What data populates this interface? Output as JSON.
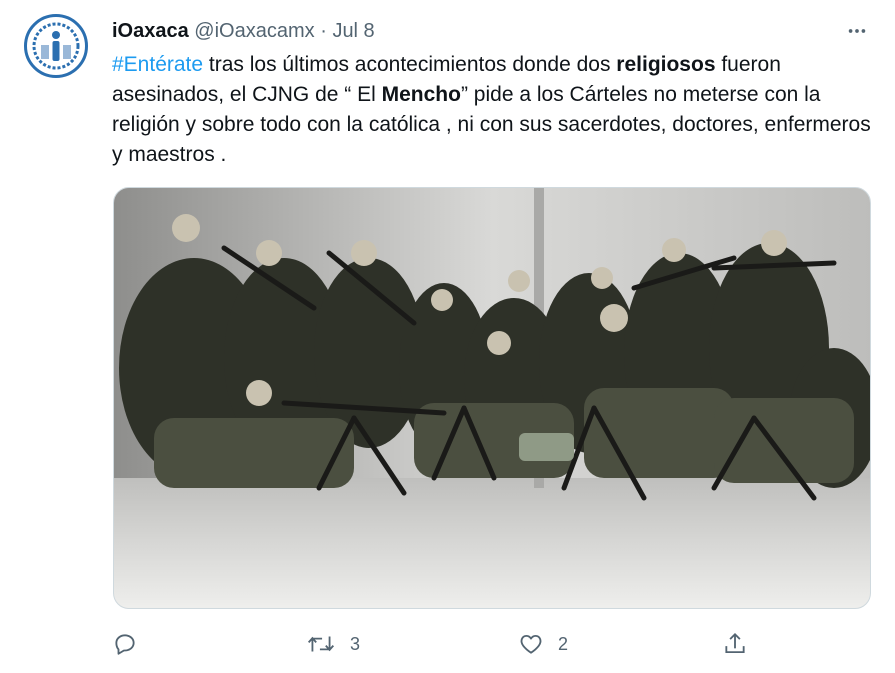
{
  "tweet": {
    "author_name": "iOaxaca",
    "author_handle": "@iOaxacamx",
    "separator": "·",
    "date": "Jul 8",
    "text": {
      "hashtag": "#Entérate",
      "part1": " tras los últimos acontecimientos donde dos ",
      "bold1": "religiosos",
      "part2": " fueron asesinados, el CJNG de “ El ",
      "bold2": "Mencho",
      "part3": "” pide a los Cárteles no meterse con la religión y sobre todo con la católica , ni con sus sacerdotes, doctores, enfermeros y maestros ."
    },
    "actions": {
      "reply_count": "",
      "retweet_count": "3",
      "like_count": "2"
    }
  },
  "colors": {
    "link": "#1d9bf0",
    "secondary_text": "#536471",
    "avatar_ring": "#2b6fb0"
  },
  "icons": [
    "more-icon",
    "reply-icon",
    "retweet-icon",
    "like-icon",
    "share-icon"
  ]
}
